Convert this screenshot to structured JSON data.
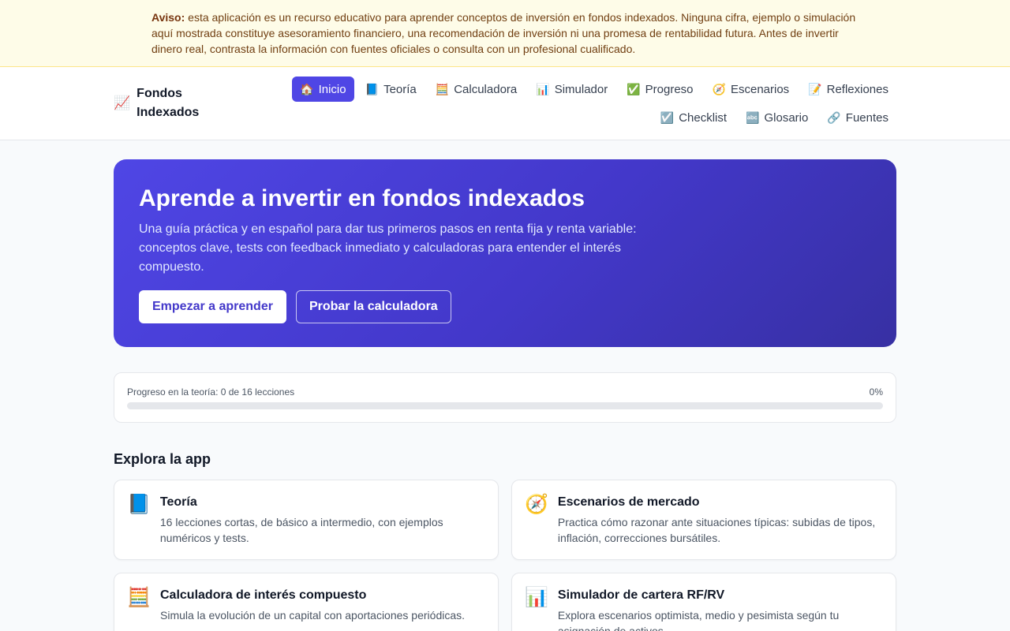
{
  "notice": {
    "label": "Aviso:",
    "text": " esta aplicación es un recurso educativo para aprender conceptos de inversión en fondos indexados. Ninguna cifra, ejemplo o simulación aquí mostrada constituye asesoramiento financiero, una recomendación de inversión ni una promesa de rentabilidad futura. Antes de invertir dinero real, contrasta la información con fuentes oficiales o consulta con un profesional cualificado."
  },
  "brand": {
    "icon": "📈",
    "name": "Fondos Indexados"
  },
  "nav": [
    {
      "icon": "🏠",
      "label": "Inicio",
      "active": true
    },
    {
      "icon": "📘",
      "label": "Teoría"
    },
    {
      "icon": "🧮",
      "label": "Calculadora"
    },
    {
      "icon": "📊",
      "label": "Simulador"
    },
    {
      "icon": "✅",
      "label": "Progreso"
    },
    {
      "icon": "🧭",
      "label": "Escenarios"
    },
    {
      "icon": "📝",
      "label": "Reflexiones"
    },
    {
      "icon": "☑️",
      "label": "Checklist"
    },
    {
      "icon": "🔤",
      "label": "Glosario"
    },
    {
      "icon": "🔗",
      "label": "Fuentes"
    }
  ],
  "hero": {
    "title": "Aprende a invertir en fondos indexados",
    "subtitle": "Una guía práctica y en español para dar tus primeros pasos en renta fija y renta variable: conceptos clave, tests con feedback inmediato y calculadoras para entender el interés compuesto.",
    "primary_button": "Empezar a aprender",
    "secondary_button": "Probar la calculadora"
  },
  "progress": {
    "label": "Progreso en la teoría: 0 de 16 lecciones",
    "percent_label": "0%",
    "fraction": 0
  },
  "explore": {
    "title": "Explora la app",
    "cards": [
      {
        "icon": "📘",
        "title": "Teoría",
        "desc": "16 lecciones cortas, de básico a intermedio, con ejemplos numéricos y tests."
      },
      {
        "icon": "🧭",
        "title": "Escenarios de mercado",
        "desc": "Practica cómo razonar ante situaciones típicas: subidas de tipos, inflación, correcciones bursátiles."
      },
      {
        "icon": "🧮",
        "title": "Calculadora de interés compuesto",
        "desc": "Simula la evolución de un capital con aportaciones periódicas."
      },
      {
        "icon": "📊",
        "title": "Simulador de cartera RF/RV",
        "desc": "Explora escenarios optimista, medio y pesimista según tu asignación de activos."
      }
    ]
  }
}
